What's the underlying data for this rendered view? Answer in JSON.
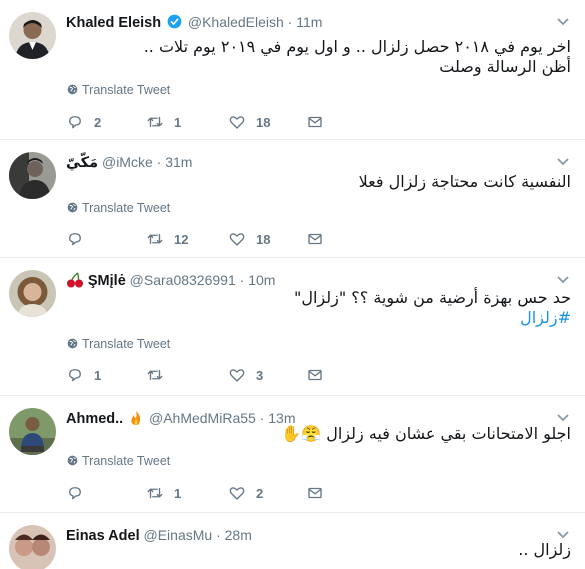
{
  "translate_label": "Translate Tweet",
  "tweets": [
    {
      "name": "Khaled Eleish",
      "verified": true,
      "handle": "@KhaledEleish",
      "dot": "·",
      "time": "11m",
      "lines": [
        "اخر يوم في ٢٠١٨ حصل زلزال .. و اول يوم في ٢٠١٩ يوم تلات ..",
        "أظن الرسالة وصلت"
      ],
      "replies": "2",
      "retweets": "1",
      "likes": "18"
    },
    {
      "name": "مَكّيّ",
      "verified": false,
      "handle": "@iMcke",
      "dot": "·",
      "time": "31m",
      "lines": [
        "النفسية كانت محتاجة زلزال فعلا"
      ],
      "replies": "",
      "retweets": "12",
      "likes": "18"
    },
    {
      "name": "ŞMįlė",
      "verified": false,
      "handle": "@Sara08326991",
      "dot": "·",
      "time": "10m",
      "lines": [
        "حد حس بهزة أرضية من شوية ؟؟ \"زلزال\"",
        "#زلزال"
      ],
      "replies": "1",
      "retweets": "",
      "likes": "3"
    },
    {
      "name": "Ahmed..",
      "verified": false,
      "handle": "@AhMedMiRa55",
      "dot": "·",
      "time": "13m",
      "lines": [
        "اجلو الامتحانات بقي عشان فيه زلزال 😤✋"
      ],
      "replies": "",
      "retweets": "1",
      "likes": "2"
    },
    {
      "name": "Einas Adel",
      "verified": false,
      "handle": "@EinasMu",
      "dot": "·",
      "time": "28m",
      "lines": [
        "زلزال .."
      ],
      "replies": "",
      "retweets": "",
      "likes": ""
    }
  ],
  "colors": {
    "text": "#14171a",
    "secondary": "#657786",
    "link": "#1b95e0",
    "verified": "#1da1f2",
    "divider": "#e6ecf0"
  }
}
